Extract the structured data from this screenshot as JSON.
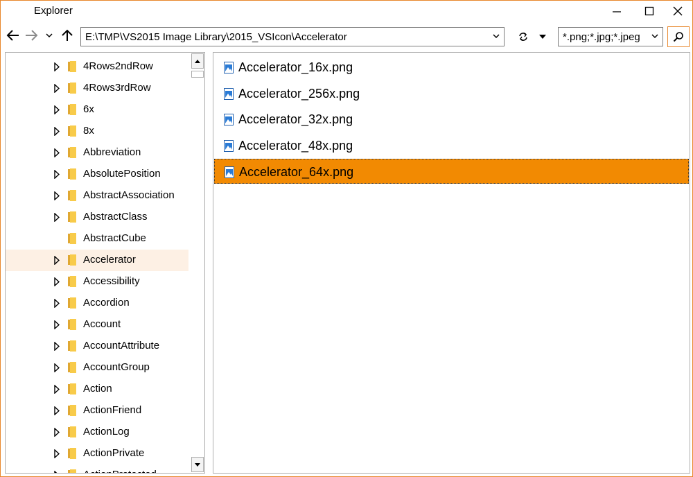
{
  "window": {
    "title": "Explorer",
    "accent_color": "#e8862a",
    "selected_color": "#f28a02"
  },
  "toolbar": {
    "back_icon": "arrow-left-icon",
    "forward_icon": "arrow-right-icon",
    "recent_icon": "chevron-down-icon",
    "up_icon": "arrow-up-icon",
    "address": "E:\\TMP\\VS2015 Image Library\\2015_VSIcon\\Accelerator",
    "refresh_icon": "refresh-icon",
    "filter": "*.png;*.jpg;*.jpeg",
    "search_icon": "search-icon"
  },
  "tree": {
    "items": [
      {
        "label": "4Rows2ndRow",
        "has_children": true,
        "selected": false
      },
      {
        "label": "4Rows3rdRow",
        "has_children": true,
        "selected": false
      },
      {
        "label": "6x",
        "has_children": true,
        "selected": false
      },
      {
        "label": "8x",
        "has_children": true,
        "selected": false
      },
      {
        "label": "Abbreviation",
        "has_children": true,
        "selected": false
      },
      {
        "label": "AbsolutePosition",
        "has_children": true,
        "selected": false
      },
      {
        "label": "AbstractAssociation",
        "has_children": true,
        "selected": false
      },
      {
        "label": "AbstractClass",
        "has_children": true,
        "selected": false
      },
      {
        "label": "AbstractCube",
        "has_children": false,
        "selected": false
      },
      {
        "label": "Accelerator",
        "has_children": true,
        "selected": true
      },
      {
        "label": "Accessibility",
        "has_children": true,
        "selected": false
      },
      {
        "label": "Accordion",
        "has_children": true,
        "selected": false
      },
      {
        "label": "Account",
        "has_children": true,
        "selected": false
      },
      {
        "label": "AccountAttribute",
        "has_children": true,
        "selected": false
      },
      {
        "label": "AccountGroup",
        "has_children": true,
        "selected": false
      },
      {
        "label": "Action",
        "has_children": true,
        "selected": false
      },
      {
        "label": "ActionFriend",
        "has_children": true,
        "selected": false
      },
      {
        "label": "ActionLog",
        "has_children": true,
        "selected": false
      },
      {
        "label": "ActionPrivate",
        "has_children": true,
        "selected": false
      },
      {
        "label": "ActionProtected",
        "has_children": true,
        "selected": false
      }
    ]
  },
  "files": {
    "items": [
      {
        "name": "Accelerator_16x.png",
        "selected": false
      },
      {
        "name": "Accelerator_256x.png",
        "selected": false
      },
      {
        "name": "Accelerator_32x.png",
        "selected": false
      },
      {
        "name": "Accelerator_48x.png",
        "selected": false
      },
      {
        "name": "Accelerator_64x.png",
        "selected": true
      }
    ]
  }
}
